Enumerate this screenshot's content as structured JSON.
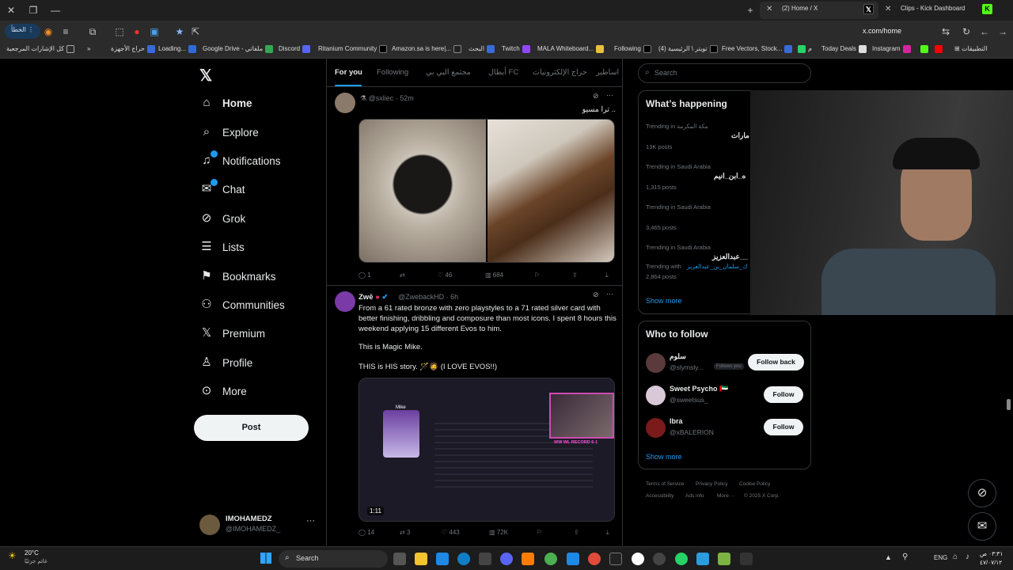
{
  "browser": {
    "tabs": [
      {
        "label": "(2) Home / X",
        "active": true
      },
      {
        "label": "Clips - Kick Dashboard",
        "active": false
      }
    ],
    "url": "x.com/home",
    "lang_button": "الخطأ",
    "bookmarks": [
      "كل الإشارات المرجعية",
      "حراج الأجهزة",
      "Loading...",
      "Google Drive - ملفاتي",
      "Discord",
      "Ritanium Community",
      "Amazon.sa is here|...",
      "البحث",
      "Twitch",
      "MALA Whiteboard...",
      "Following",
      "تويتر \\ الرئيسية (4)",
      "Free Vectors, Stock...",
      "م",
      "Today Deals",
      "Instagram",
      "التطبيقات"
    ]
  },
  "nav": {
    "items": [
      {
        "label": "Home",
        "icon": "home-icon"
      },
      {
        "label": "Explore",
        "icon": "search-icon"
      },
      {
        "label": "Notifications",
        "icon": "bell-icon"
      },
      {
        "label": "Chat",
        "icon": "mail-icon"
      },
      {
        "label": "Grok",
        "icon": "grok-icon"
      },
      {
        "label": "Lists",
        "icon": "list-icon"
      },
      {
        "label": "Bookmarks",
        "icon": "bookmark-icon"
      },
      {
        "label": "Communities",
        "icon": "people-icon"
      },
      {
        "label": "Premium",
        "icon": "x-logo-icon"
      },
      {
        "label": "Profile",
        "icon": "person-icon"
      },
      {
        "label": "More",
        "icon": "more-circle-icon"
      }
    ],
    "post_label": "Post",
    "profile": {
      "name": "IMOHAMEDZ",
      "handle": "@IMOHAMEDZ_"
    }
  },
  "feed": {
    "tabs": [
      "For you",
      "Following",
      "مجتمع البي بي",
      "أبطال FC",
      "حراج الإلكترونيات",
      "اساطير"
    ],
    "tweet1": {
      "handle": "@sxliec · 52m",
      "text": "ترا مسيو ..",
      "stats": {
        "replies": "1",
        "retweets": "",
        "likes": "46",
        "views": "684"
      }
    },
    "tweet2": {
      "name": "Zwē",
      "handle": "@ZwebackHD · 6h",
      "text1": "From a 61 rated bronze with zero playstyles to a 71 rated silver card with better finishing, dribbling and composure than most icons. I spent 8 hours this weekend applying 15 different Evos to him.",
      "text2": "This is Magic Mike.",
      "text3": "THIS is HIS story. 🪄🧔 (I LOVE EVOS!!)",
      "video_time": "1:11",
      "video_banner": "WW WL RECORD 6-1",
      "player_name": "Mike",
      "stats": {
        "replies": "14",
        "retweets": "3",
        "likes": "443",
        "views": "72K"
      }
    }
  },
  "right": {
    "search_placeholder": "Search",
    "happening_title": "What’s happening",
    "trends": [
      {
        "meta": "Trending in مكة المكرمة",
        "name": "مارات",
        "posts": "13K posts"
      },
      {
        "meta": "Trending in Saudi Arabia",
        "name": "ه_ابن_انيم",
        "posts": "1,315 posts"
      },
      {
        "meta": "Trending in Saudi Arabia",
        "name": "",
        "posts": "3,465 posts"
      },
      {
        "meta": "Trending in Saudi Arabia",
        "name": "عبدالعزيز__",
        "with_label": "Trending with",
        "with_value": "ك_سلمان_بن_عبدالعزيز",
        "posts": "2,864 posts"
      }
    ],
    "show_more": "Show more",
    "who_title": "Who to follow",
    "follow": [
      {
        "name": "سلوم",
        "handle": "@slymsly...",
        "badge": "Follows you",
        "button": "Follow back"
      },
      {
        "name": "Sweet Psycho 🇦🇪",
        "handle": "@sweetsus_",
        "button": "Follow"
      },
      {
        "name": "Ibra",
        "handle": "@xBALERION",
        "button": "Follow"
      }
    ],
    "footer": [
      "Terms of Service",
      "Privacy Policy",
      "Cookie Policy",
      "Accessibility",
      "Ads info",
      "More ···",
      "© 2025 X Corp."
    ]
  },
  "taskbar": {
    "weather_temp": "20°C",
    "weather_desc": "غائم جزئيًا",
    "search_label": "Search",
    "lang": "ENG",
    "time": "٠٣:٣١ ص",
    "date": "٤٧/٠٧/١٢"
  }
}
